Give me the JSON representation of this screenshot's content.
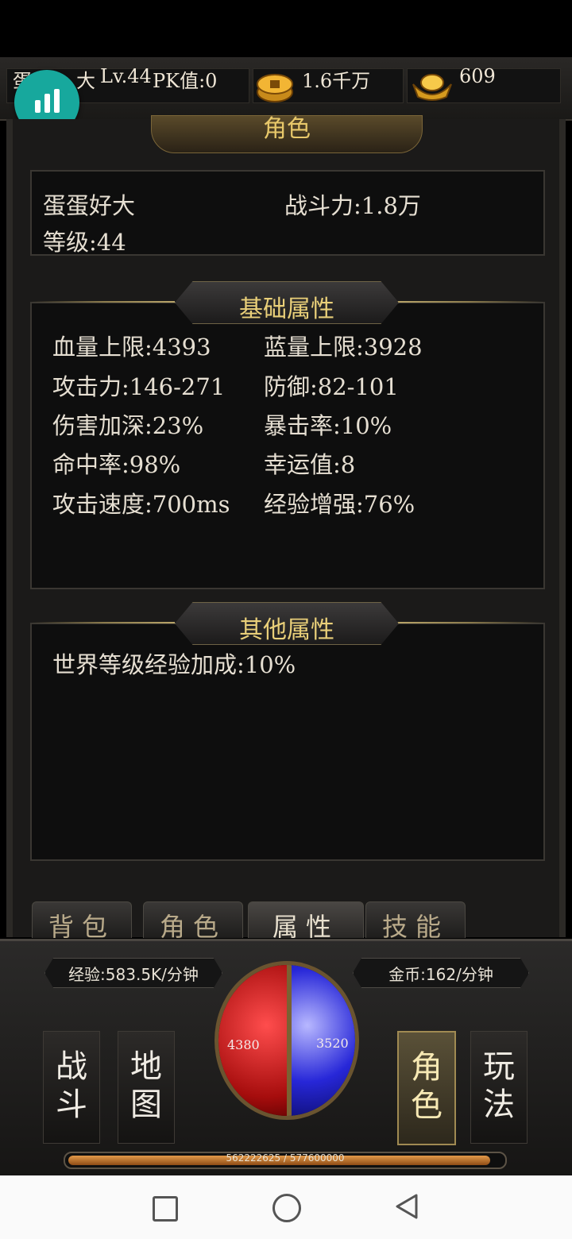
{
  "header": {
    "player_name_partial": "蛋",
    "player_name_tail": "大",
    "level": "Lv.44",
    "pk": "PK值:0",
    "gold": "1.6千万",
    "ingot": "609"
  },
  "panel_title": "角色",
  "character": {
    "name": "蛋蛋好大",
    "combat_power": "战斗力:1.8万",
    "level": "等级:44"
  },
  "basic_attributes": {
    "title": "基础属性",
    "items": [
      "血量上限:4393",
      "蓝量上限:3928",
      "攻击力:146-271",
      "防御:82-101",
      "伤害加深:23%",
      "暴击率:10%",
      "命中率:98%",
      "幸运值:8",
      "攻击速度:700ms",
      "经验增强:76%"
    ]
  },
  "other_attributes": {
    "title": "其他属性",
    "items": [
      "世界等级经验加成:10%"
    ]
  },
  "tabs": [
    "背包",
    "角色",
    "属性",
    "技能"
  ],
  "active_tab": "属性",
  "hud": {
    "exp_rate": "经验:583.5K/分钟",
    "gold_rate": "金币:162/分钟",
    "hp": "4380",
    "mp": "3520",
    "nav": [
      "战斗",
      "地图",
      "角色",
      "玩法"
    ],
    "active_nav": "角色",
    "xp_text": "562222625 / 577600000",
    "xp_progress": 0.973
  },
  "colors": {
    "accent_gold": "#e9cf79",
    "fab": "#17a89d"
  }
}
